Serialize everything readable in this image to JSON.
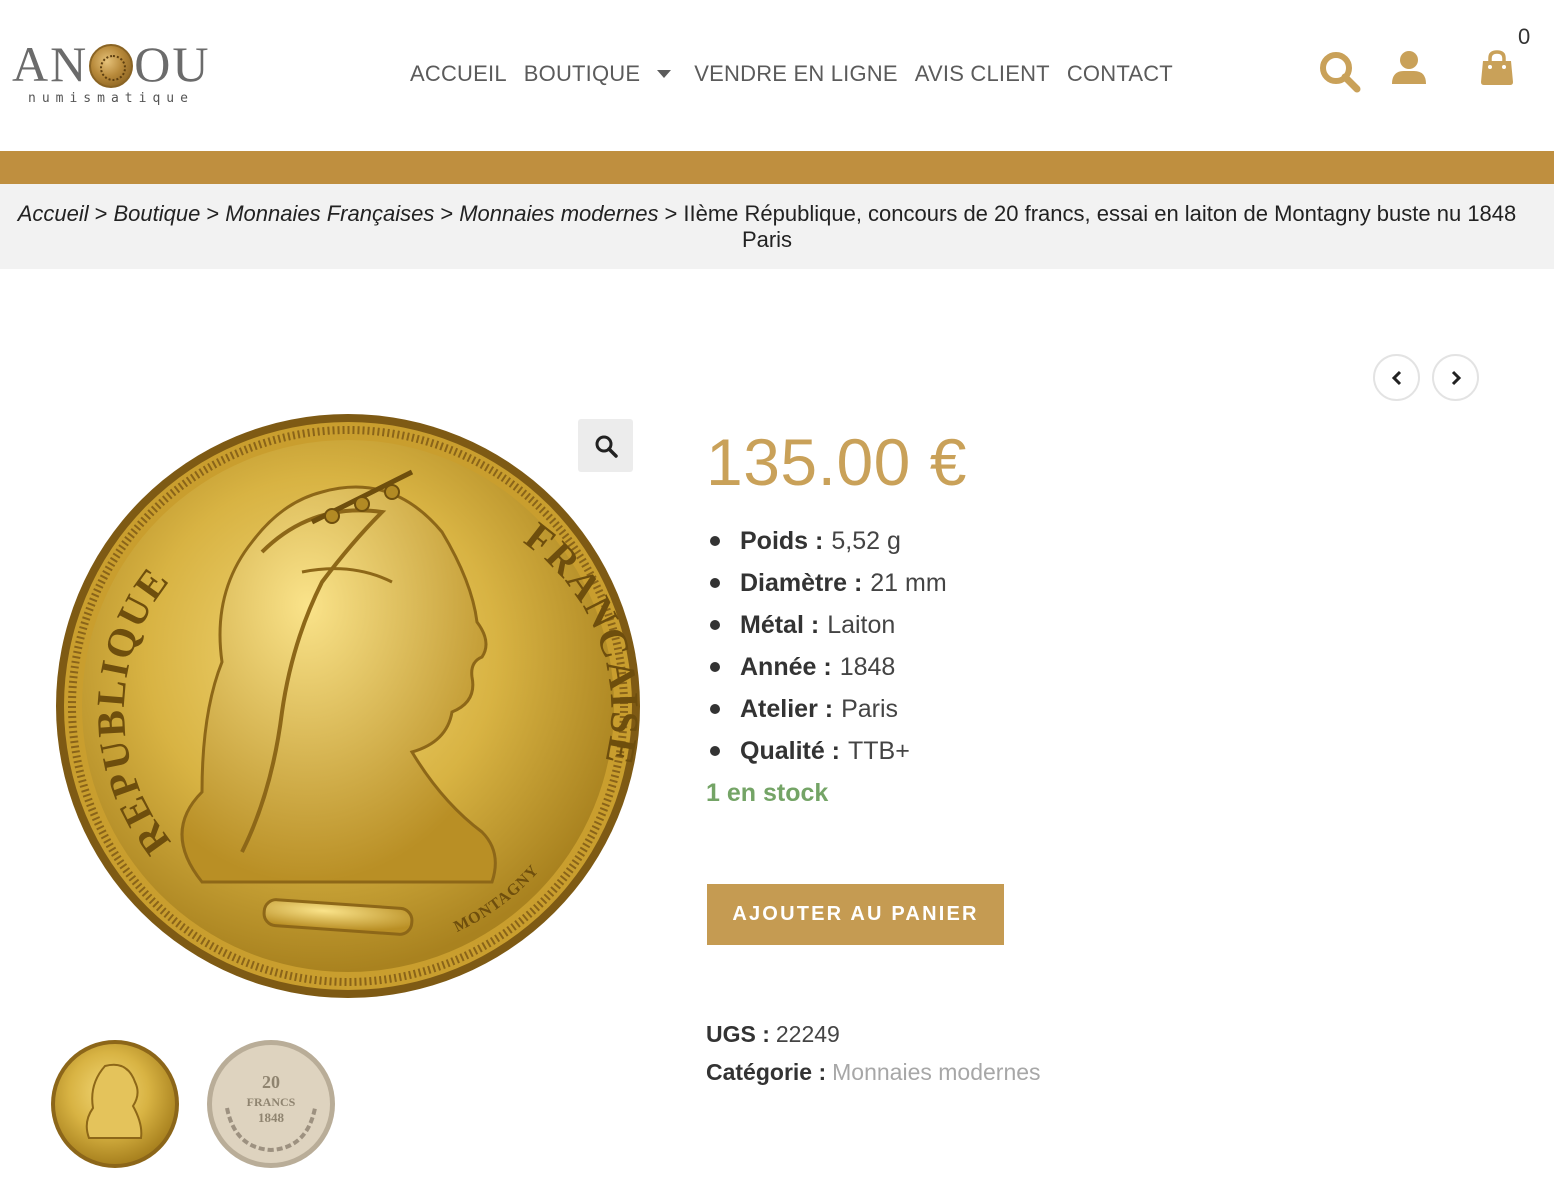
{
  "brand": {
    "logo_word_left": "AN",
    "logo_word_right": "OU",
    "logo_sub": "numismatique"
  },
  "nav": {
    "items": [
      "ACCUEIL",
      "BOUTIQUE",
      "VENDRE EN LIGNE",
      "AVIS CLIENT",
      "CONTACT"
    ]
  },
  "header": {
    "cart_count": "0",
    "icons": [
      "search-icon",
      "user-icon",
      "shopping-bag-icon"
    ],
    "accent_color": "#c9a159",
    "band_color": "#bf8f3f"
  },
  "breadcrumb": {
    "links": [
      "Accueil",
      "Boutique",
      "Monnaies Françaises",
      "Monnaies modernes"
    ],
    "separator": ">",
    "current": "IIème République, concours de 20 francs, essai en laiton de Montagny buste nu 1848 Paris"
  },
  "product": {
    "price": "135.00 €",
    "specs": [
      {
        "label": "Poids :",
        "value": "5,52 g"
      },
      {
        "label": "Diamètre :",
        "value": "21 mm"
      },
      {
        "label": "Métal :",
        "value": "Laiton"
      },
      {
        "label": "Année :",
        "value": "1848"
      },
      {
        "label": "Atelier :",
        "value": "Paris"
      },
      {
        "label": "Qualité :",
        "value": "TTB+"
      }
    ],
    "stock": "1 en stock",
    "stock_color": "#74a466",
    "add_to_cart": "AJOUTER AU PANIER",
    "sku_label": "UGS :",
    "sku": "22249",
    "category_label": "Catégorie :",
    "category": "Monnaies modernes"
  },
  "coin": {
    "obverse_left": "REPUBLIQUE",
    "obverse_right": "FRANCAISE",
    "engraver": "MONTAGNY",
    "reverse_value": "20",
    "reverse_unit": "FRANCS",
    "reverse_year": "1848"
  }
}
